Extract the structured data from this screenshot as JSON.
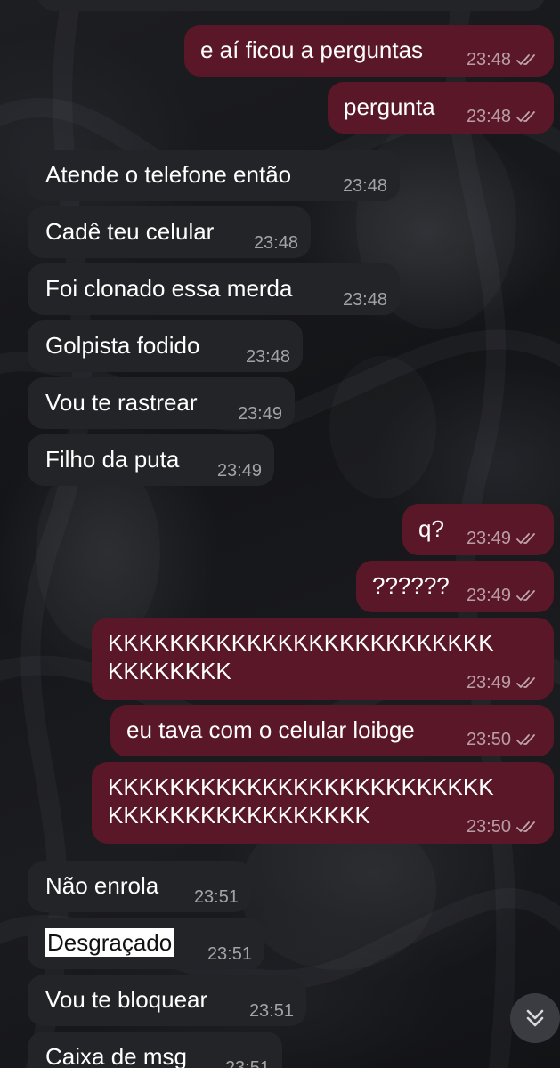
{
  "messages": [
    {
      "dir": "out",
      "text": "e aí ficou a perguntas",
      "time": "23:48"
    },
    {
      "dir": "out",
      "text": "pergunta",
      "time": "23:48"
    },
    {
      "dir": "in",
      "text": "Atende o telefone então",
      "time": "23:48"
    },
    {
      "dir": "in",
      "text": "Cadê teu celular",
      "time": "23:48"
    },
    {
      "dir": "in",
      "text": "Foi clonado essa merda",
      "time": "23:48"
    },
    {
      "dir": "in",
      "text": "Golpista fodido",
      "time": "23:48"
    },
    {
      "dir": "in",
      "text": "Vou te rastrear",
      "time": "23:49"
    },
    {
      "dir": "in",
      "text": "Filho da puta",
      "time": "23:49"
    },
    {
      "dir": "out",
      "text": "q?",
      "time": "23:49"
    },
    {
      "dir": "out",
      "text": "??????",
      "time": "23:49"
    },
    {
      "dir": "out",
      "text": "KKKKKKKKKKKKKKKKKKKKKKKKK\nKKKKKKKK",
      "time": "23:49"
    },
    {
      "dir": "out",
      "text": "eu tava com o celular loibge",
      "time": "23:50"
    },
    {
      "dir": "out",
      "text": "KKKKKKKKKKKKKKKKKKKKKKKKK\nKKKKKKKKKKKKKKKKK",
      "time": "23:50"
    },
    {
      "dir": "in",
      "text": "Não enrola",
      "time": "23:51"
    },
    {
      "dir": "in",
      "text": "Desgraçado",
      "time": "23:51",
      "selected": true
    },
    {
      "dir": "in",
      "text": "Vou te bloquear",
      "time": "23:51"
    },
    {
      "dir": "in",
      "text": "Caixa de msg",
      "time": "23:51"
    }
  ],
  "icons": {
    "read_receipt": "double-check-icon",
    "scroll_down": "chevron-double-down-icon"
  },
  "colors": {
    "outgoing_bubble": "#5a1727",
    "incoming_bubble": "#232427",
    "text": "#ffffff"
  }
}
